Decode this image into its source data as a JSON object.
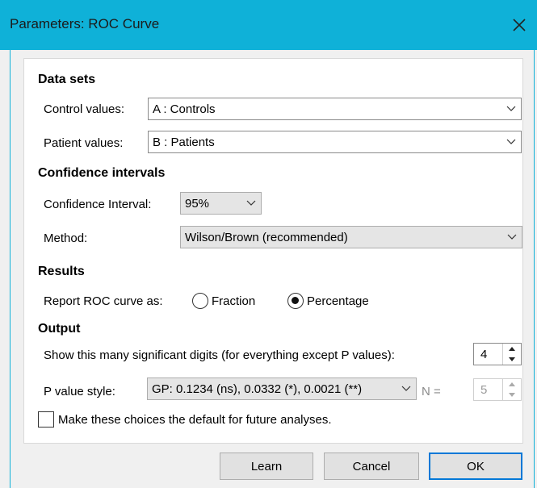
{
  "window": {
    "title": "Parameters: ROC Curve"
  },
  "data_sets": {
    "heading": "Data sets",
    "control_label": "Control values:",
    "control_value": "A : Controls",
    "patient_label": "Patient values:",
    "patient_value": "B : Patients"
  },
  "confidence": {
    "heading": "Confidence intervals",
    "ci_label": "Confidence Interval:",
    "ci_value": "95%",
    "method_label": "Method:",
    "method_value": "Wilson/Brown (recommended)"
  },
  "results": {
    "heading": "Results",
    "report_label": "Report ROC curve as:",
    "fraction_label": "Fraction",
    "percentage_label": "Percentage",
    "selected": "Percentage"
  },
  "output": {
    "heading": "Output",
    "digits_label": "Show this many significant digits (for everything except P values):",
    "digits_value": "4",
    "pstyle_label": "P value style:",
    "pstyle_value": "GP: 0.1234 (ns), 0.0332 (*), 0.0021 (**)",
    "n_label": "N =",
    "n_value": "5"
  },
  "default_checkbox": {
    "label": "Make these choices the default for future analyses.",
    "checked": false
  },
  "buttons": {
    "learn": "Learn",
    "cancel": "Cancel",
    "ok": "OK"
  },
  "colors": {
    "titlebar": "#0fb1d8",
    "default_button_border": "#0078d7"
  }
}
